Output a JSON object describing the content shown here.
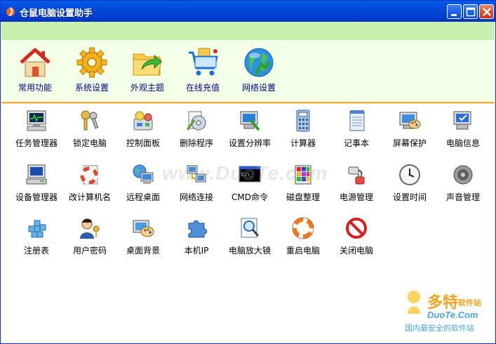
{
  "window": {
    "title": "仓鼠电脑设置助手"
  },
  "toolbar": {
    "items": [
      {
        "label": "常用功能",
        "icon": "home-icon"
      },
      {
        "label": "系统设置",
        "icon": "gear-icon"
      },
      {
        "label": "外观主题",
        "icon": "folder-arrow-icon"
      },
      {
        "label": "在线充值",
        "icon": "shopping-cart-icon"
      },
      {
        "label": "网络设置",
        "icon": "globe-icon"
      }
    ]
  },
  "grid": {
    "rows": [
      [
        {
          "label": "任务管理器",
          "icon": "monitor-icon"
        },
        {
          "label": "锁定电脑",
          "icon": "keys-icon"
        },
        {
          "label": "控制面板",
          "icon": "control-panel-icon"
        },
        {
          "label": "删除程序",
          "icon": "uninstall-icon"
        },
        {
          "label": "设置分辨率",
          "icon": "resolution-icon"
        },
        {
          "label": "计算器",
          "icon": "calculator-icon"
        },
        {
          "label": "记事本",
          "icon": "notepad-icon"
        },
        {
          "label": "屏幕保护",
          "icon": "screensaver-icon"
        },
        {
          "label": "电脑信息",
          "icon": "computer-info-icon"
        }
      ],
      [
        {
          "label": "设备管理器",
          "icon": "device-manager-icon"
        },
        {
          "label": "改计算机名",
          "icon": "lifebuoy-icon"
        },
        {
          "label": "远程桌面",
          "icon": "remote-desktop-icon"
        },
        {
          "label": "网络连接",
          "icon": "network-icon"
        },
        {
          "label": "CMD命令",
          "icon": "cmd-icon"
        },
        {
          "label": "磁盘整理",
          "icon": "defrag-icon"
        },
        {
          "label": "电源管理",
          "icon": "power-icon"
        },
        {
          "label": "设置时间",
          "icon": "clock-icon"
        },
        {
          "label": "声音管理",
          "icon": "speaker-icon"
        }
      ],
      [
        {
          "label": "注册表",
          "icon": "registry-icon"
        },
        {
          "label": "用户密码",
          "icon": "user-key-icon"
        },
        {
          "label": "桌面背景",
          "icon": "palette-icon"
        },
        {
          "label": "本机IP",
          "icon": "puzzle-icon"
        },
        {
          "label": "电脑放大镜",
          "icon": "magnifier-icon"
        },
        {
          "label": "重启电脑",
          "icon": "restart-icon"
        },
        {
          "label": "关闭电脑",
          "icon": "shutdown-icon"
        }
      ]
    ]
  },
  "branding": {
    "watermark": "www.DuoTe.com",
    "logo_cn": "多特",
    "logo_cn2": "软件站",
    "logo_site": "DuoTe.Com",
    "logo_slogan": "国内最安全的软件站"
  },
  "colors": {
    "titlebar": "#0347d6",
    "band": "#c7efad",
    "toolbar_bg": "#f4ffe8",
    "separator": "#f4a93a",
    "tool_label": "#000080"
  }
}
